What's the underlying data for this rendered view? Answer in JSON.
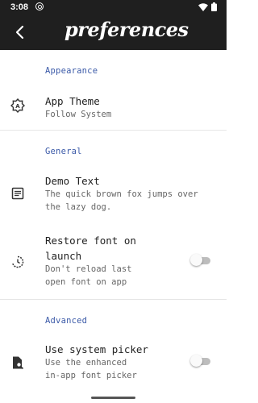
{
  "status_bar": {
    "time": "3:08",
    "icons": [
      "notification-icon",
      "wifi-icon",
      "battery-icon"
    ]
  },
  "app_bar": {
    "title": "preferences",
    "back_icon": "arrow-back-icon"
  },
  "sections": {
    "appearance": {
      "header": "Appearance",
      "app_theme": {
        "title": "App Theme",
        "summary": "Follow System",
        "icon": "brightness-icon"
      }
    },
    "general": {
      "header": "General",
      "demo_text": {
        "title": "Demo Text",
        "summary_line1": "The quick brown fox jumps over",
        "summary_line2": "the lazy dog.",
        "icon": "article-icon"
      },
      "restore_font": {
        "title_line1": "Restore font on",
        "title_line2": "launch",
        "summary_line1": "Don't reload last",
        "summary_line2": "open font on app",
        "icon": "history-icon",
        "toggle_on": false
      }
    },
    "advanced": {
      "header": "Advanced",
      "system_picker": {
        "title": "Use system picker",
        "summary_line1": "Use the enhanced",
        "summary_line2": "in-app font picker",
        "icon": "file-search-icon",
        "toggle_on": false
      }
    }
  },
  "colors": {
    "app_bar": "#1f1f1f",
    "section_header": "#3b5aa8",
    "divider": "#e6e6e6"
  }
}
